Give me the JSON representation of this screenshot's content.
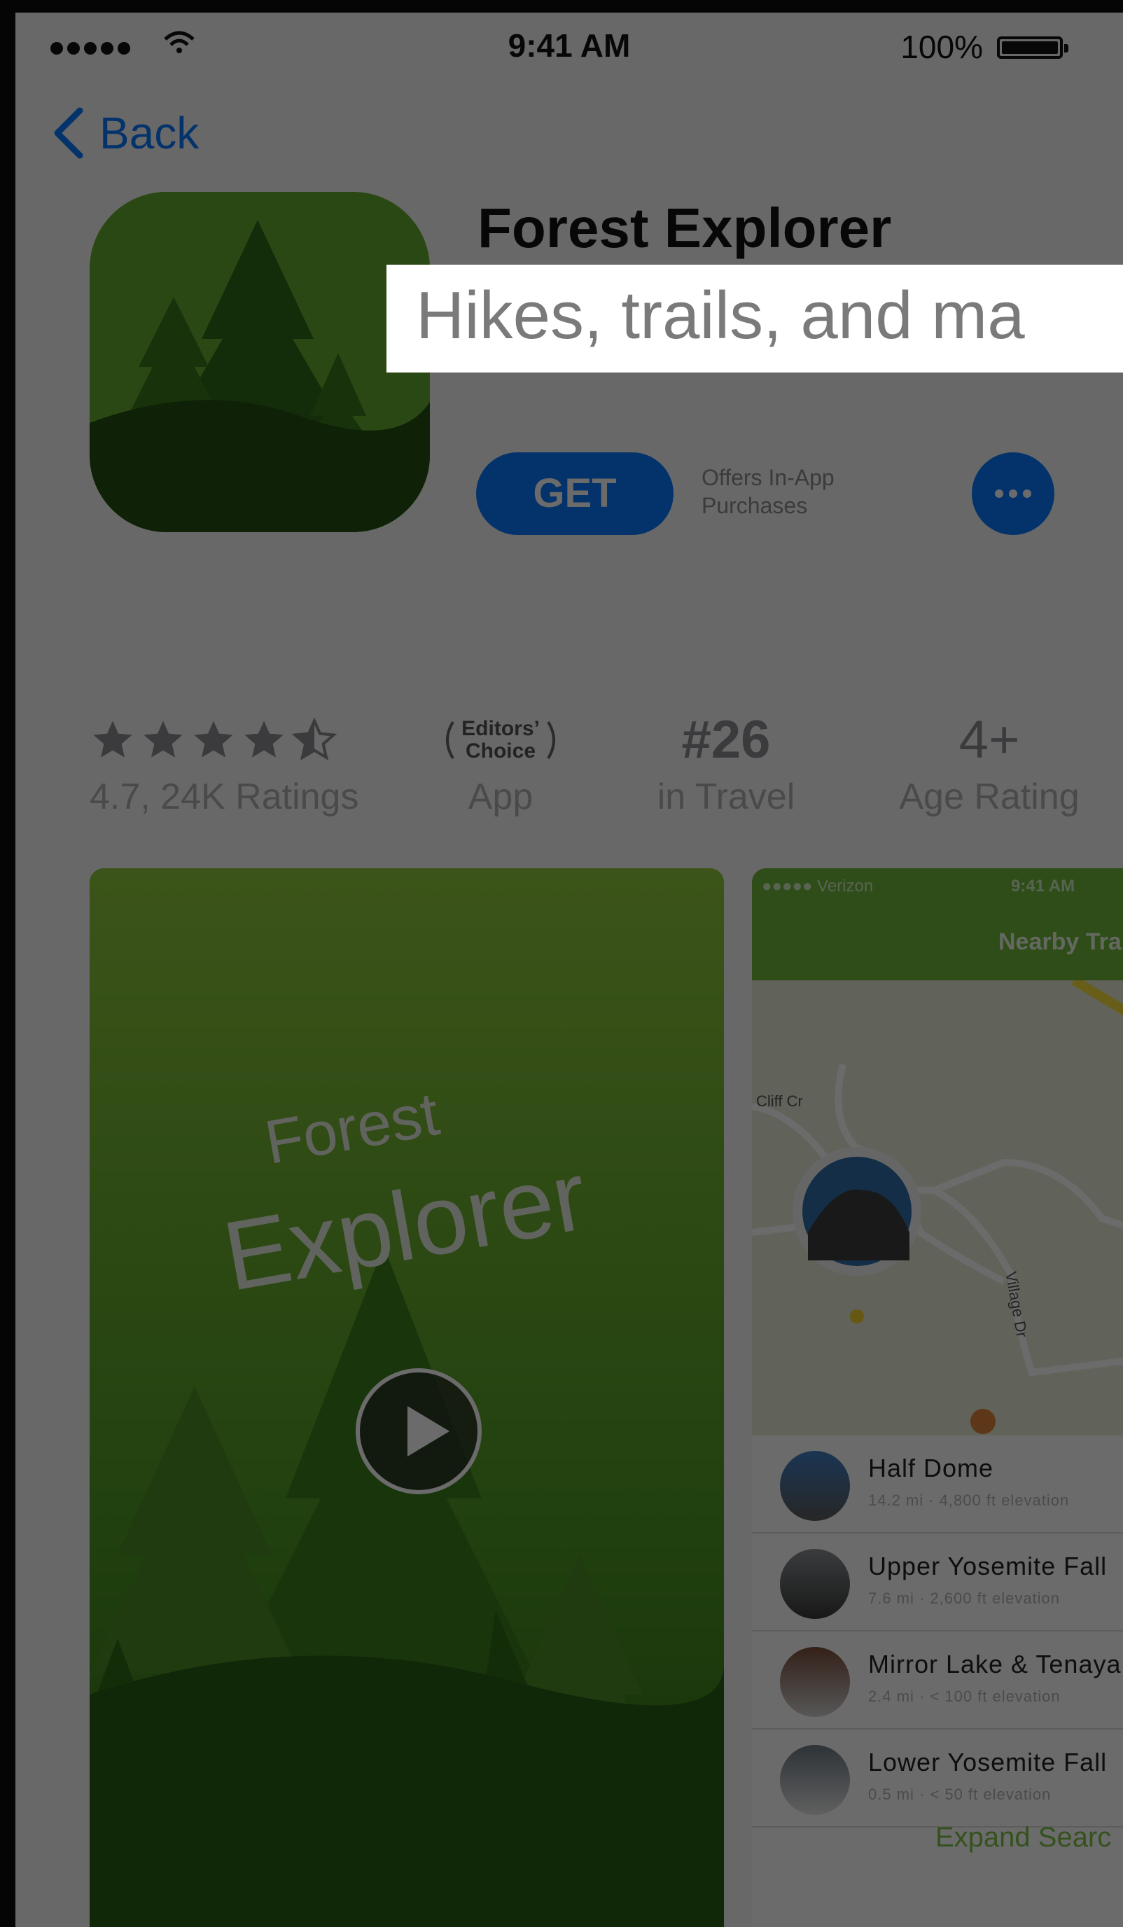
{
  "status_bar": {
    "time": "9:41 AM",
    "battery": "100%"
  },
  "nav": {
    "back_label": "Back"
  },
  "app": {
    "title": "Forest Explorer",
    "subtitle": "Hikes, trails, and ma",
    "get_label": "GET",
    "iap_line1": "Offers In-App",
    "iap_line2": "Purchases"
  },
  "info": {
    "rating_value": 4.7,
    "rating_text": "4.7, 24K Ratings",
    "editors_line1": "Editors’",
    "editors_line2": "Choice",
    "editors_sub": "App",
    "rank": "#26",
    "rank_sub": "in Travel",
    "age": "4+",
    "age_sub": "Age Rating"
  },
  "screenshot1": {
    "line1": "Forest",
    "line2": "Explorer"
  },
  "screenshot2": {
    "carrier": "●●●●● Verizon",
    "time": "9:41 AM",
    "nav_title": "Nearby Tra",
    "map_labels": {
      "street1": "Cliff Cr",
      "street2": "Village Dr"
    },
    "trails": [
      {
        "name": "Half Dome",
        "meta": "14.2 mi · 4,800 ft elevation"
      },
      {
        "name": "Upper Yosemite Fall",
        "meta": "7.6 mi · 2,600 ft elevation"
      },
      {
        "name": "Mirror Lake & Tenaya",
        "meta": "2.4 mi · < 100 ft elevation"
      },
      {
        "name": "Lower Yosemite Fall",
        "meta": "0.5 mi · < 50 ft elevation"
      }
    ],
    "expand": "Expand Searc"
  },
  "colors": {
    "accent": "#0a7aff",
    "forest_green": "#6fb73a"
  }
}
